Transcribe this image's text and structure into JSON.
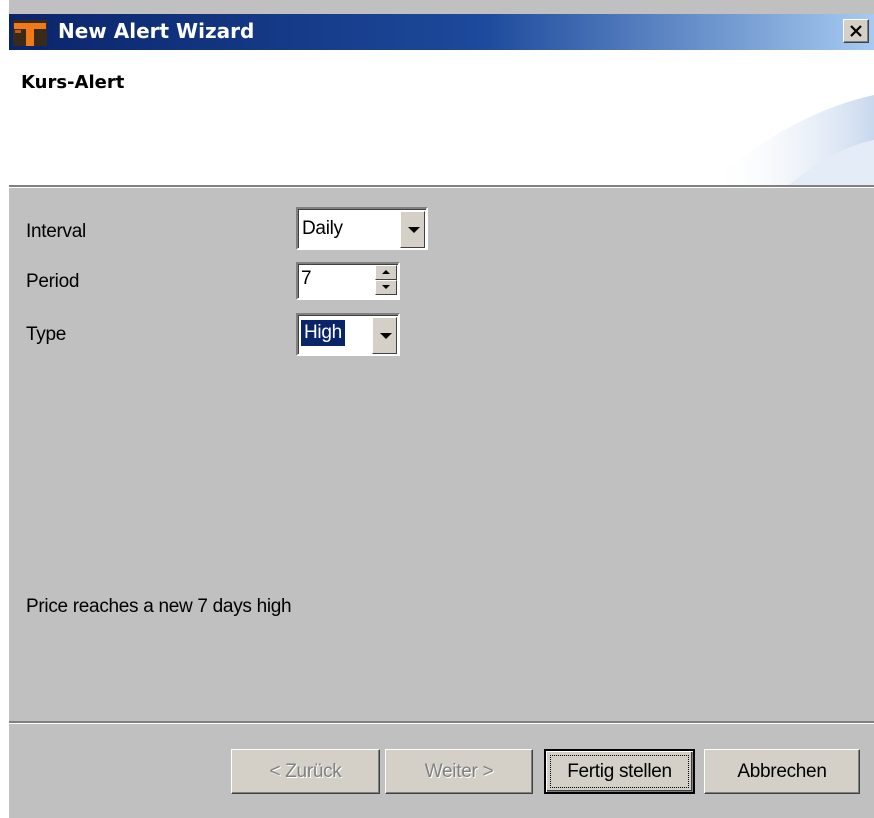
{
  "window": {
    "title": "New Alert Wizard",
    "close_symbol": "✕",
    "app_icon": "wizard-app-icon"
  },
  "header": {
    "title": "Kurs-Alert"
  },
  "form": {
    "interval": {
      "label": "Interval",
      "value": "Daily"
    },
    "period": {
      "label": "Period",
      "value": "7"
    },
    "type": {
      "label": "Type",
      "value": "High"
    }
  },
  "description": "Price reaches a new 7 days high",
  "buttons": {
    "back": "< Zurück",
    "next": "Weiter >",
    "finish": "Fertig stellen",
    "cancel": "Abbrechen"
  },
  "colors": {
    "title_bar_start": "#0a246a",
    "title_bar_end": "#a6caf0",
    "dialog_background": "#c0c0c0",
    "selection": "#0a246a"
  }
}
